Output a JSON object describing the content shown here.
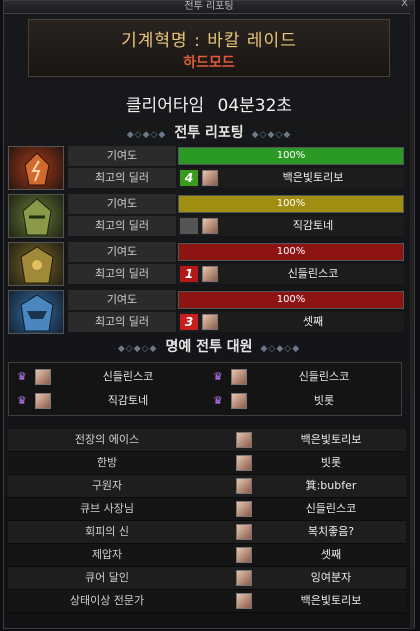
{
  "window": {
    "title": "전투 리포팅",
    "close": "X"
  },
  "raid": {
    "title": "기계혁명 : 바칼 레이드",
    "mode": "하드모드"
  },
  "clear": {
    "label": "클리어타임",
    "time": "04분32초"
  },
  "report": {
    "title": "전투 리포팅"
  },
  "row_labels": {
    "contribution": "기여도",
    "best_dealer": "최고의 딜러"
  },
  "players": [
    {
      "pct_text": "100%",
      "fill": 1.0,
      "color": "#2a9a25",
      "rank": "4",
      "rank_color": "#3a9a1e",
      "dealer": "백은빛토리보"
    },
    {
      "pct_text": "100%",
      "fill": 1.0,
      "color": "#a08e12",
      "rank": "",
      "rank_color": "#555555",
      "dealer": "직감토네"
    },
    {
      "pct_text": "100%",
      "fill": 1.0,
      "color": "#8e1414",
      "rank": "1",
      "rank_color": "#b21818",
      "dealer": "신들린스코"
    },
    {
      "pct_text": "100%",
      "fill": 1.0,
      "color": "#8e1414",
      "rank": "3",
      "rank_color": "#c81e1e",
      "dealer": "셋째"
    }
  ],
  "honor": {
    "title": "명예 전투 대원",
    "members": [
      "신들린스코",
      "신들린스코",
      "직감토네",
      "빗롯"
    ]
  },
  "awards": [
    {
      "title": "전장의 에이스",
      "name": "백은빛토리보"
    },
    {
      "title": "한방",
      "name": "빗롯"
    },
    {
      "title": "구원자",
      "name": "箕:bubfer"
    },
    {
      "title": "큐브 사장님",
      "name": "신들린스코"
    },
    {
      "title": "회피의 신",
      "name": "복치좋음?"
    },
    {
      "title": "제압자",
      "name": "셋째"
    },
    {
      "title": "큐어 달인",
      "name": "잉여분자"
    },
    {
      "title": "상태이상 전문가",
      "name": "백은빛토리보"
    }
  ]
}
